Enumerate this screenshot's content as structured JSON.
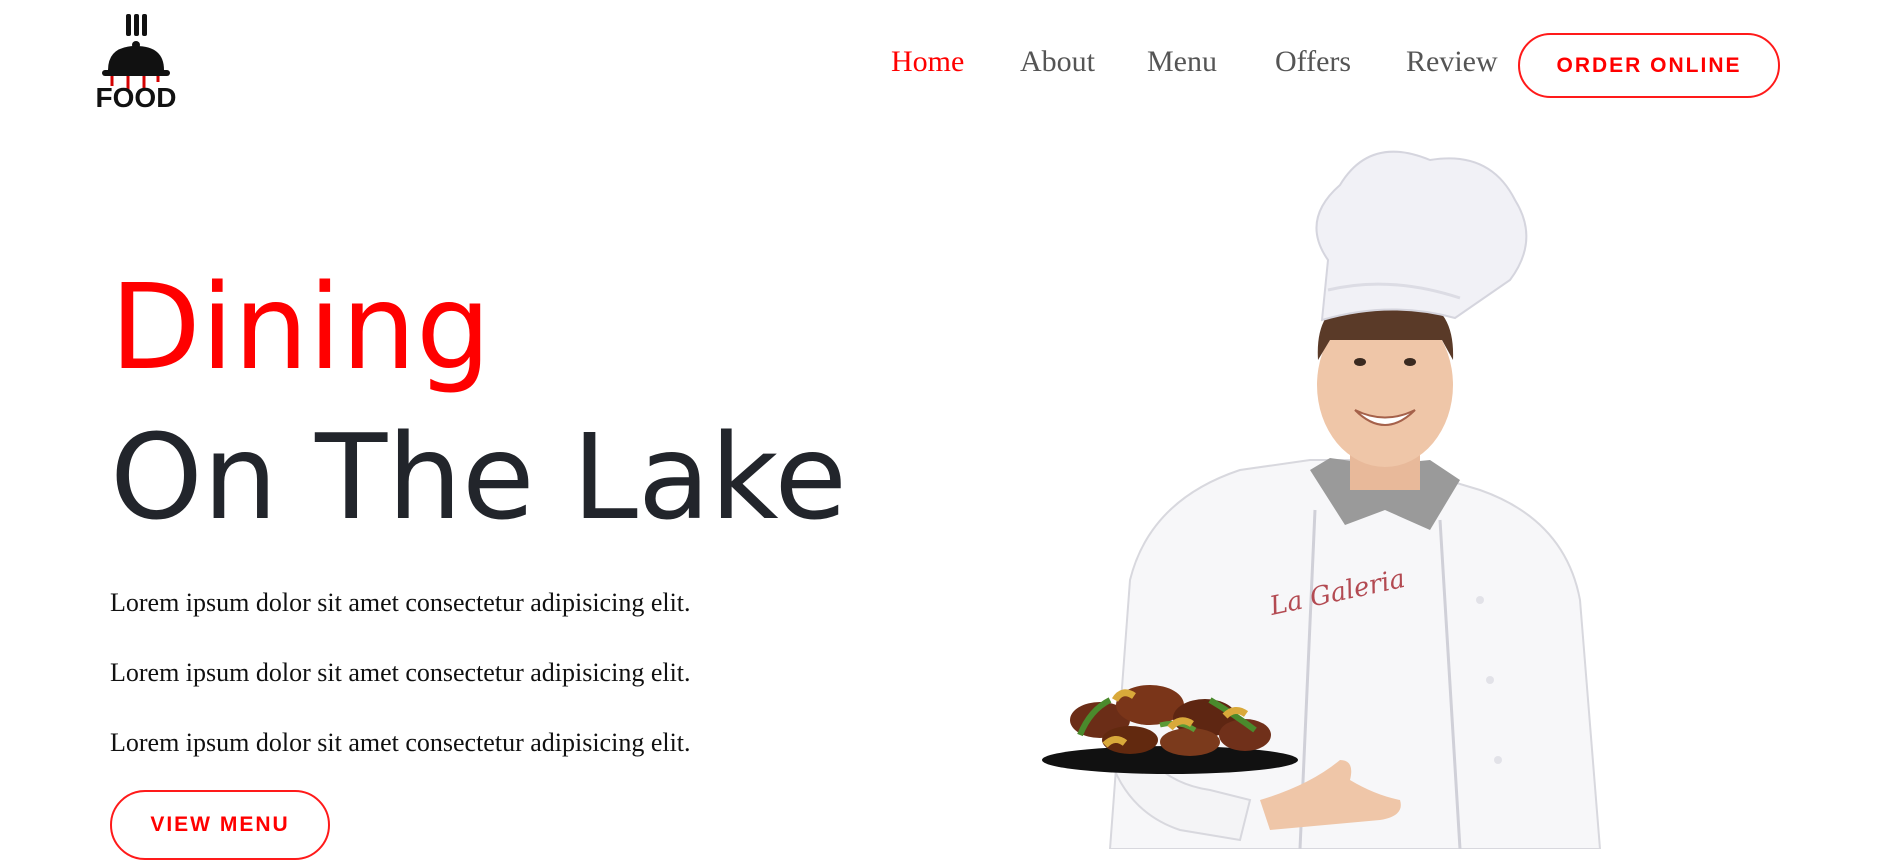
{
  "brand": {
    "logo_text": "FOOD"
  },
  "nav": {
    "items": [
      {
        "label": "Home",
        "active": true
      },
      {
        "label": "About",
        "active": false
      },
      {
        "label": "Menu",
        "active": false
      },
      {
        "label": "Offers",
        "active": false
      },
      {
        "label": "Review",
        "active": false
      }
    ],
    "order_button": "ORDER ONLINE"
  },
  "hero": {
    "title_line1": "Dining",
    "title_line2": "On The Lake",
    "paragraphs": [
      "Lorem ipsum dolor sit amet consectetur adipisicing elit.",
      "Lorem ipsum dolor sit amet consectetur adipisicing elit.",
      "Lorem ipsum dolor sit amet consectetur adipisicing elit."
    ],
    "menu_button": "VIEW MENU"
  },
  "image": {
    "embroidery_text": "La Galeria"
  },
  "colors": {
    "accent": "#ff0000",
    "heading": "#22252b",
    "nav_text": "#555555"
  }
}
